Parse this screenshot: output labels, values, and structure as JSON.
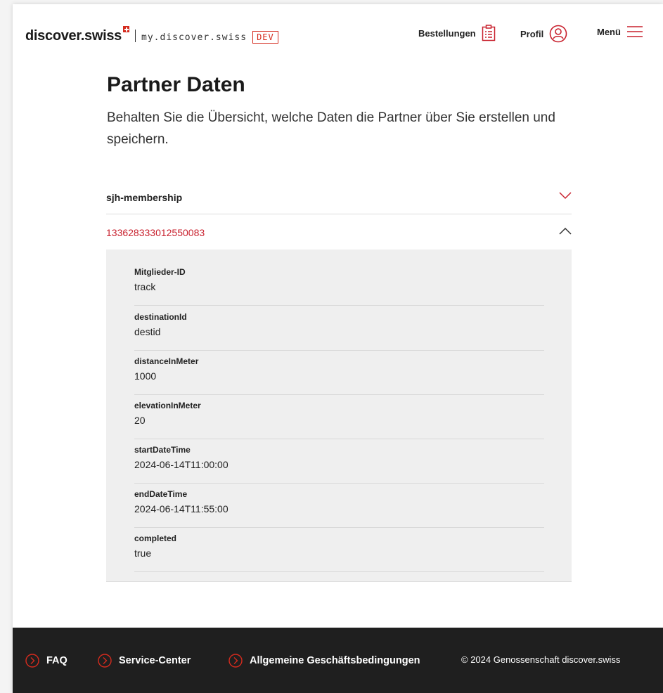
{
  "header": {
    "logo": "discover.swiss",
    "subdomain": "my.discover.swiss",
    "env_badge": "DEV",
    "nav": {
      "orders": "Bestellungen",
      "profile": "Profil",
      "menu": "Menü"
    }
  },
  "main": {
    "title": "Partner Daten",
    "subtitle": "Behalten Sie die Übersicht, welche Daten die Partner über Sie erstellen und speichern."
  },
  "accordion": {
    "items": [
      {
        "label": "sjh-membership",
        "expanded": false
      },
      {
        "label": "133628333012550083",
        "expanded": true
      }
    ],
    "fields": [
      {
        "label": "Mitglieder-ID",
        "value": "track"
      },
      {
        "label": "destinationId",
        "value": "destid"
      },
      {
        "label": "distanceInMeter",
        "value": "1000"
      },
      {
        "label": "elevationInMeter",
        "value": "20"
      },
      {
        "label": "startDateTime",
        "value": "2024-06-14T11:00:00"
      },
      {
        "label": "endDateTime",
        "value": "2024-06-14T11:55:00"
      },
      {
        "label": "completed",
        "value": "true"
      }
    ]
  },
  "footer": {
    "links": [
      "FAQ",
      "Service-Center",
      "Allgemeine Geschäftsbedingungen"
    ],
    "copyright": "© 2024 Genossenschaft discover.swiss"
  },
  "colors": {
    "accent": "#d52b1e",
    "active_text": "#c8202d",
    "footer_bg": "#1f1f1f",
    "panel_bg": "#efefef"
  },
  "icons": {
    "orders": "clipboard-icon",
    "profile": "user-circle-icon",
    "menu": "hamburger-menu-icon",
    "collapsed": "chevron-down-icon",
    "expanded": "chevron-up-icon",
    "footer_link": "circle-chevron-right-icon"
  }
}
